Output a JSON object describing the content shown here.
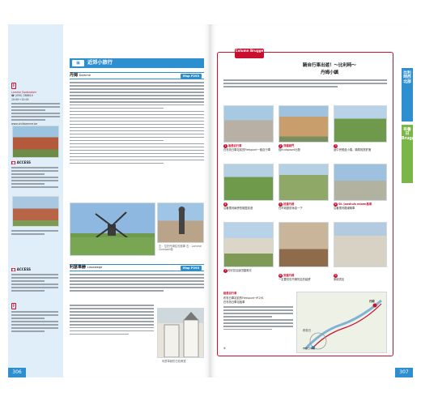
{
  "left_page": {
    "page_number": "306",
    "section_title": "近郊小旅行",
    "places": [
      {
        "name": "丹姆",
        "name_en": "Damme",
        "map_ref": "Map P293"
      },
      {
        "name": "利瑟韋赫",
        "name_en": "Lissewege",
        "map_ref": "Map P293"
      }
    ],
    "sidebar": {
      "tourist_office_name": "Lamme Goedzakstr",
      "address_line": "☎ (050) 288610",
      "hours_line": "10:00～12:00",
      "website": "www.visitdamme.be",
      "access_label": "ACCESS",
      "access_label_2": "ACCESS",
      "info_label": "i",
      "info_label_2": "i"
    },
    "photo_caption_1": "左：位於丹姆往的風車 右：Lamme Goedzak像",
    "photo_caption_2": "利瑟韋赫的白色教堂"
  },
  "right_page": {
    "page_number": "307",
    "column_badge": "Column Brugge",
    "column_title": "騎自行車出遊！～比利時～",
    "column_subtitle": "丹姆小鎮",
    "steps": [
      {
        "num": "1",
        "title": "租借自行車",
        "text": "在布魯日車站前的Fietspunt一租自行車"
      },
      {
        "num": "2",
        "title": "穿越城門",
        "text": "從Kruispoort出發"
      },
      {
        "num": "3",
        "title": "",
        "text": "途中會經過小橋，騎乘相當舒適"
      },
      {
        "num": "4",
        "title": "",
        "text": "沿著運河兩旁的樹蔭前進"
      },
      {
        "num": "5",
        "title": "抵達丹姆",
        "text": "在市政廳前休息一下"
      },
      {
        "num": "6",
        "title": "St. Janshuis mioen風車",
        "text": "沿著運河路線騎車"
      },
      {
        "num": "7",
        "title": "",
        "text": "可欣賞沿途田園風光"
      },
      {
        "num": "8",
        "title": "到達丹姆",
        "text": "一定要嘗嘗丹姆知名的鬆餅"
      },
      {
        "num": "9",
        "title": "",
        "text": "參觀書店"
      }
    ],
    "rental_title": "租借自行車",
    "rental_lines": [
      "布魯日車站前的Fietspunt→P.291",
      "在布魯日車站租車"
    ],
    "rental_note": "※",
    "tab_main": "比利時西北部",
    "tab_sub": "布魯日Brugge",
    "map_label_damme": "丹姆",
    "map_label_brugge": "布魯日",
    "map_label_station": "布魯日車站"
  },
  "colors": {
    "accent_blue": "#2e8fd0",
    "accent_red": "#c8102e",
    "sidebar_bg": "#dfeef8",
    "tab_green": "#7ab648"
  }
}
